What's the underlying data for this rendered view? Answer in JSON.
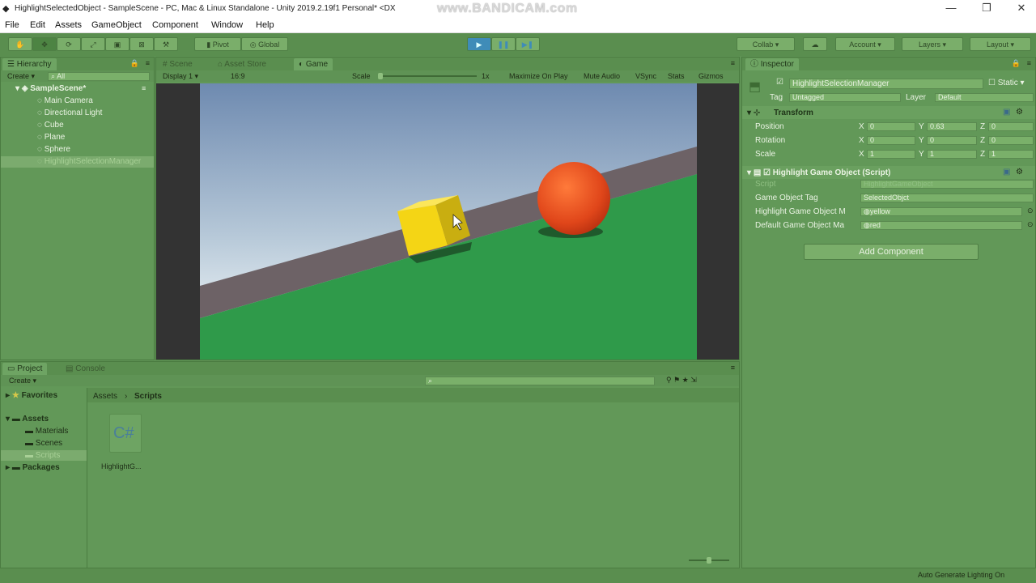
{
  "window": {
    "title": "HighlightSelectedObject - SampleScene - PC, Mac & Linux Standalone - Unity 2019.2.19f1 Personal* <DX",
    "watermark": "www.BANDICAM.com",
    "minimize": "—",
    "maximize": "❐",
    "close": "✕"
  },
  "menu": [
    "File",
    "Edit",
    "Assets",
    "GameObject",
    "Component",
    "Window",
    "Help"
  ],
  "toolbar": {
    "pivot": "Pivot",
    "global": "Global",
    "collab": "Collab ▾",
    "account": "Account",
    "layers": "Layers",
    "layout": "Layout"
  },
  "hierarchy": {
    "tab": "Hierarchy",
    "create": "Create ▾",
    "search_placeholder": "All",
    "scene": "SampleScene*",
    "items": [
      "Main Camera",
      "Directional Light",
      "Cube",
      "Plane",
      "Sphere",
      "HighlightSelectionManager"
    ]
  },
  "center_tabs": [
    "Scene",
    "Asset Store",
    "Game"
  ],
  "game_bar": {
    "display": "Display 1",
    "aspect": "16:9",
    "scale_label": "Scale",
    "scale_value": "1x",
    "maximize": "Maximize On Play",
    "mute": "Mute Audio",
    "vsync": "VSync",
    "stats": "Stats",
    "gizmos": "Gizmos"
  },
  "inspector": {
    "tab": "Inspector",
    "object_name": "HighlightSelectionManager",
    "static_label": "Static",
    "tag_label": "Tag",
    "tag_value": "Untagged",
    "layer_label": "Layer",
    "layer_value": "Default",
    "transform": {
      "title": "Transform",
      "position_label": "Position",
      "rotation_label": "Rotation",
      "scale_label": "Scale",
      "x": "X",
      "y": "Y",
      "z": "Z",
      "position": [
        "0",
        "0.63",
        "0"
      ],
      "rotation": [
        "0",
        "0",
        "0"
      ],
      "scale": [
        "1",
        "1",
        "1"
      ]
    },
    "script": {
      "title": "Highlight Game Object (Script)",
      "script_label": "Script",
      "script_value": "HighlightGameObject",
      "tag_label": "Game Object Tag",
      "tag_value": "SelectedObjct",
      "highlight_label": "Highlight Game Object M",
      "highlight_value": "yellow",
      "default_label": "Default Game Object Ma",
      "default_value": "red"
    },
    "add_component": "Add Component"
  },
  "project": {
    "tabs": [
      "Project",
      "Console"
    ],
    "create": "Create ▾",
    "favorites": "Favorites",
    "assets": "Assets",
    "folders": [
      "Materials",
      "Scenes",
      "Scripts"
    ],
    "packages": "Packages",
    "breadcrumb": [
      "Assets",
      "Scripts"
    ],
    "file_icon": "C#",
    "file_name": "HighlightG..."
  },
  "status": "Auto Generate Lighting On"
}
